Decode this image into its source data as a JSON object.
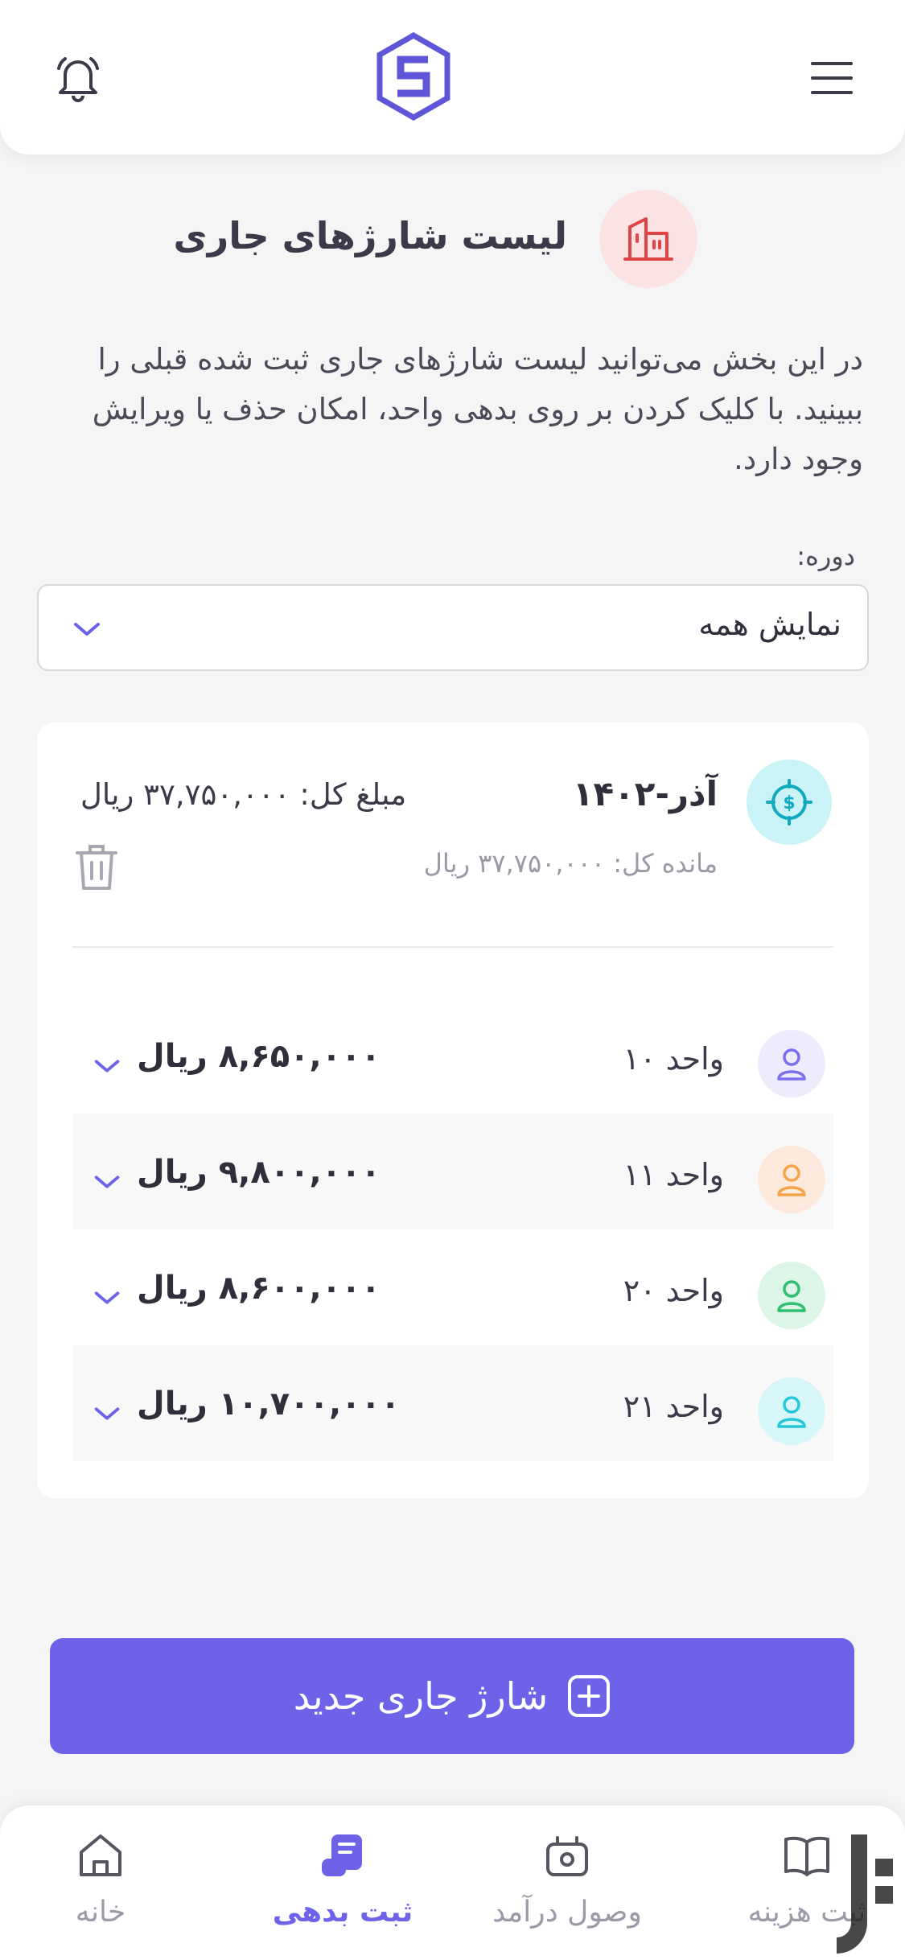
{
  "header": {
    "menu_icon": "hamburger-menu-icon",
    "logo": "app-logo-s",
    "bell_icon": "bell-icon"
  },
  "page": {
    "title": "لیست شارژهای جاری",
    "description": "در این بخش می‌توانید لیست شارژهای جاری ثبت شده قبلی را ببینید. با کلیک کردن بر روی بدهی واحد، امکان حذف یا ویرایش وجود دارد."
  },
  "filter": {
    "label": "دوره:",
    "selected": "نمایش همه"
  },
  "card": {
    "period": "آذر-۱۴۰۲",
    "total": "مبلغ کل: ۳۷,۷۵۰,۰۰۰ ریال",
    "remaining": "مانده کل: ۳۷,۷۵۰,۰۰۰ ریال",
    "units": [
      {
        "name": "واحد ۱۰",
        "amount": "۸,۶۵۰,۰۰۰ ریال",
        "color": "#7b6ff0"
      },
      {
        "name": "واحد ۱۱",
        "amount": "۹,۸۰۰,۰۰۰ ریال",
        "color": "#f4a44a"
      },
      {
        "name": "واحد ۲۰",
        "amount": "۸,۶۰۰,۰۰۰ ریال",
        "color": "#2fbf71"
      },
      {
        "name": "واحد ۲۱",
        "amount": "۱۰,۷۰۰,۰۰۰ ریال",
        "color": "#27c6d8"
      }
    ]
  },
  "new_button": {
    "label": "شارژ جاری جدید"
  },
  "bottom_nav": [
    {
      "label": "ثبت هزینه",
      "icon": "book-icon"
    },
    {
      "label": "وصول درآمد",
      "icon": "cash-register-icon"
    },
    {
      "label": "ثبت بدهی",
      "icon": "scroll-icon",
      "active": true
    },
    {
      "label": "خانه",
      "icon": "home-icon"
    }
  ],
  "colors": {
    "accent": "#6e62e8",
    "background": "#f5f5f6"
  }
}
